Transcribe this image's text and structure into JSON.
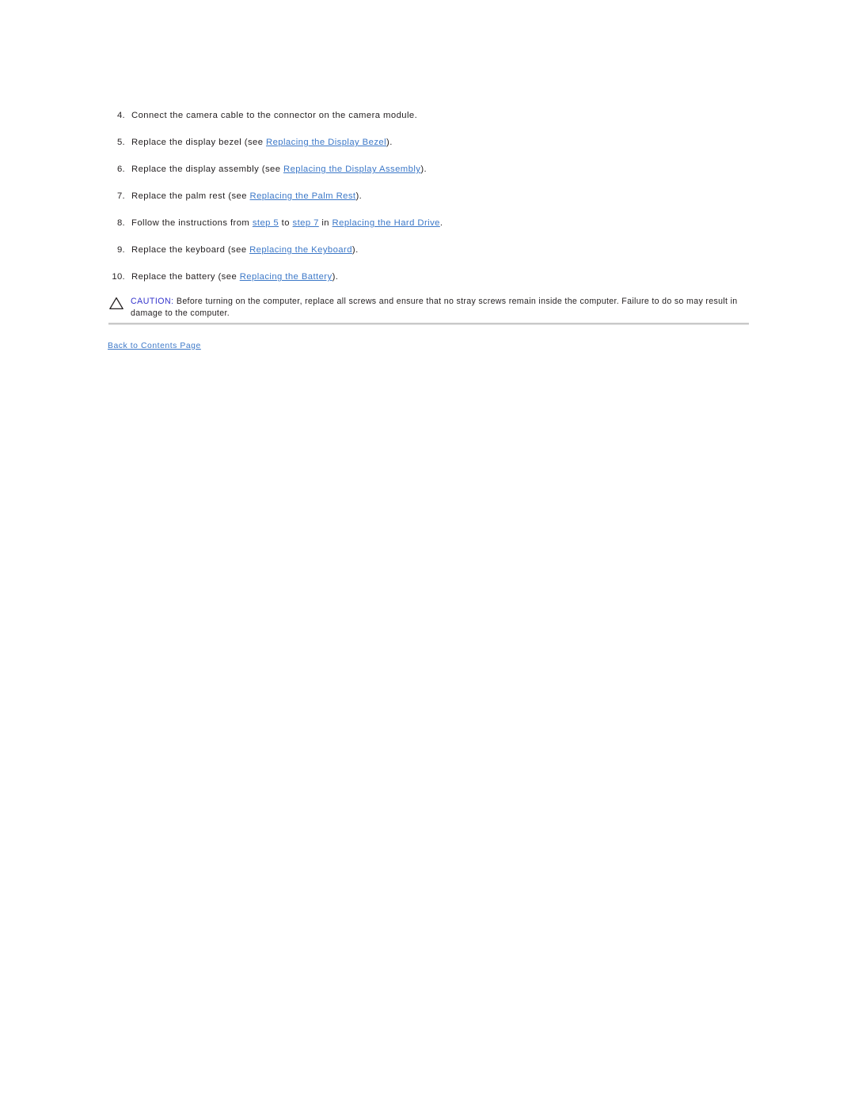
{
  "document": {
    "background_color": "#ffffff",
    "text_color": "#231f20",
    "link_color": "#3c78c8",
    "caution_label_color": "#3333cc",
    "rule_color": "#c9c9c9"
  },
  "procedure": {
    "items": [
      {
        "number": "4.",
        "segments": [
          {
            "type": "text",
            "value": "Connect the camera cable to the connector on the camera module."
          }
        ]
      },
      {
        "number": "5.",
        "segments": [
          {
            "type": "text",
            "value": "Replace the display bezel (see "
          },
          {
            "type": "link",
            "value": "Replacing the Display Bezel"
          },
          {
            "type": "text",
            "value": ")."
          }
        ]
      },
      {
        "number": "6.",
        "segments": [
          {
            "type": "text",
            "value": "Replace the display assembly (see "
          },
          {
            "type": "link",
            "value": "Replacing the Display Assembly"
          },
          {
            "type": "text",
            "value": ")."
          }
        ]
      },
      {
        "number": "7.",
        "segments": [
          {
            "type": "text",
            "value": "Replace the palm rest (see "
          },
          {
            "type": "link",
            "value": "Replacing the Palm Rest"
          },
          {
            "type": "text",
            "value": ")."
          }
        ]
      },
      {
        "number": "8.",
        "segments": [
          {
            "type": "text",
            "value": "Follow the instructions from "
          },
          {
            "type": "link",
            "value": "step 5"
          },
          {
            "type": "text",
            "value": " to "
          },
          {
            "type": "link",
            "value": "step 7"
          },
          {
            "type": "text",
            "value": " in "
          },
          {
            "type": "link",
            "value": "Replacing the Hard Drive"
          },
          {
            "type": "text",
            "value": "."
          }
        ]
      },
      {
        "number": "9.",
        "segments": [
          {
            "type": "text",
            "value": "Replace the keyboard (see "
          },
          {
            "type": "link",
            "value": "Replacing the Keyboard"
          },
          {
            "type": "text",
            "value": ")."
          }
        ]
      },
      {
        "number": "10.",
        "segments": [
          {
            "type": "text",
            "value": "Replace the battery (see "
          },
          {
            "type": "link",
            "value": "Replacing the Battery"
          },
          {
            "type": "text",
            "value": ")."
          }
        ]
      }
    ]
  },
  "caution": {
    "icon": "warning-triangle-icon",
    "label": "CAUTION:",
    "body": " Before turning on the computer, replace all screws and ensure that no stray screws remain inside the computer. Failure to do so may result in damage to the computer."
  },
  "footer": {
    "back_link": "Back to Contents Page"
  }
}
